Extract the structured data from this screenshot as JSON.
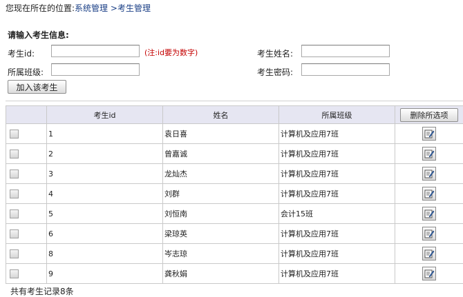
{
  "breadcrumb": {
    "prefix": "您现在所在的位置:",
    "level1": "系统管理",
    "sep": ">",
    "level2": "考生管理"
  },
  "form": {
    "title": "请输入考生信息:",
    "student_id_label": "考生id:",
    "student_id_value": "",
    "id_note": "(注:id要为数字)",
    "name_label": "考生姓名:",
    "name_value": "",
    "class_label": "所属班级:",
    "class_value": "",
    "password_label": "考生密码:",
    "password_value": "",
    "add_button": "加入该考生"
  },
  "table": {
    "columns": [
      "",
      "考生id",
      "姓名",
      "所属班级"
    ],
    "delete_button": "删除所选项",
    "rows": [
      {
        "id": "1",
        "name": "袁日喜",
        "class": "计算机及应用7班"
      },
      {
        "id": "2",
        "name": "曾嘉诚",
        "class": "计算机及应用7班"
      },
      {
        "id": "3",
        "name": "龙灿杰",
        "class": "计算机及应用7班"
      },
      {
        "id": "4",
        "name": "刘群",
        "class": "计算机及应用7班"
      },
      {
        "id": "5",
        "name": "刘恒南",
        "class": "会计15班"
      },
      {
        "id": "6",
        "name": "梁琼英",
        "class": "计算机及应用7班"
      },
      {
        "id": "8",
        "name": "岑志琼",
        "class": "计算机及应用7班"
      },
      {
        "id": "9",
        "name": "龚秋娟",
        "class": "计算机及应用7班"
      }
    ],
    "row_icon": "edit-icon"
  },
  "footer": {
    "record_count": "共有考生记录8条"
  },
  "colors": {
    "link": "#1a3f86",
    "note": "#c40000",
    "header_bg": "#e6e6f2"
  }
}
